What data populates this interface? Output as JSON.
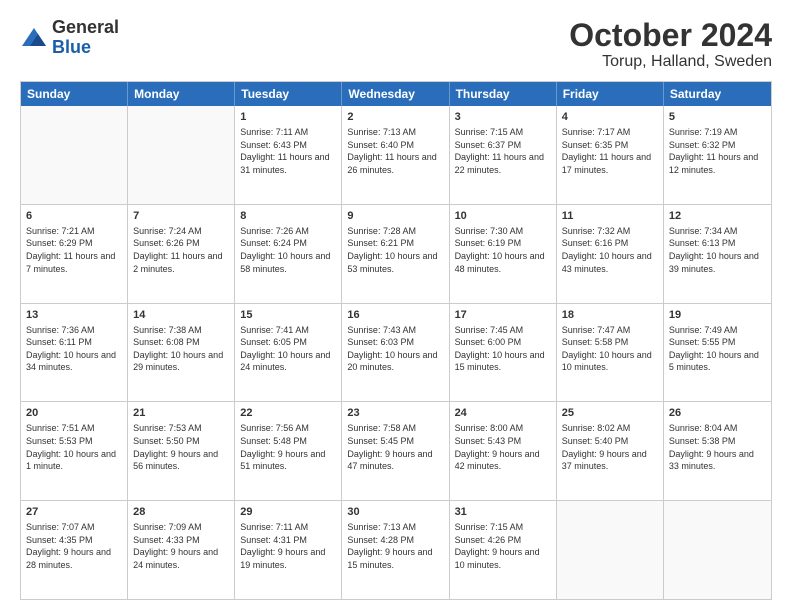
{
  "header": {
    "logo_general": "General",
    "logo_blue": "Blue",
    "title": "October 2024",
    "subtitle": "Torup, Halland, Sweden"
  },
  "days_of_week": [
    "Sunday",
    "Monday",
    "Tuesday",
    "Wednesday",
    "Thursday",
    "Friday",
    "Saturday"
  ],
  "weeks": [
    [
      {
        "day": "",
        "info": ""
      },
      {
        "day": "",
        "info": ""
      },
      {
        "day": "1",
        "info": "Sunrise: 7:11 AM\nSunset: 6:43 PM\nDaylight: 11 hours and 31 minutes."
      },
      {
        "day": "2",
        "info": "Sunrise: 7:13 AM\nSunset: 6:40 PM\nDaylight: 11 hours and 26 minutes."
      },
      {
        "day": "3",
        "info": "Sunrise: 7:15 AM\nSunset: 6:37 PM\nDaylight: 11 hours and 22 minutes."
      },
      {
        "day": "4",
        "info": "Sunrise: 7:17 AM\nSunset: 6:35 PM\nDaylight: 11 hours and 17 minutes."
      },
      {
        "day": "5",
        "info": "Sunrise: 7:19 AM\nSunset: 6:32 PM\nDaylight: 11 hours and 12 minutes."
      }
    ],
    [
      {
        "day": "6",
        "info": "Sunrise: 7:21 AM\nSunset: 6:29 PM\nDaylight: 11 hours and 7 minutes."
      },
      {
        "day": "7",
        "info": "Sunrise: 7:24 AM\nSunset: 6:26 PM\nDaylight: 11 hours and 2 minutes."
      },
      {
        "day": "8",
        "info": "Sunrise: 7:26 AM\nSunset: 6:24 PM\nDaylight: 10 hours and 58 minutes."
      },
      {
        "day": "9",
        "info": "Sunrise: 7:28 AM\nSunset: 6:21 PM\nDaylight: 10 hours and 53 minutes."
      },
      {
        "day": "10",
        "info": "Sunrise: 7:30 AM\nSunset: 6:19 PM\nDaylight: 10 hours and 48 minutes."
      },
      {
        "day": "11",
        "info": "Sunrise: 7:32 AM\nSunset: 6:16 PM\nDaylight: 10 hours and 43 minutes."
      },
      {
        "day": "12",
        "info": "Sunrise: 7:34 AM\nSunset: 6:13 PM\nDaylight: 10 hours and 39 minutes."
      }
    ],
    [
      {
        "day": "13",
        "info": "Sunrise: 7:36 AM\nSunset: 6:11 PM\nDaylight: 10 hours and 34 minutes."
      },
      {
        "day": "14",
        "info": "Sunrise: 7:38 AM\nSunset: 6:08 PM\nDaylight: 10 hours and 29 minutes."
      },
      {
        "day": "15",
        "info": "Sunrise: 7:41 AM\nSunset: 6:05 PM\nDaylight: 10 hours and 24 minutes."
      },
      {
        "day": "16",
        "info": "Sunrise: 7:43 AM\nSunset: 6:03 PM\nDaylight: 10 hours and 20 minutes."
      },
      {
        "day": "17",
        "info": "Sunrise: 7:45 AM\nSunset: 6:00 PM\nDaylight: 10 hours and 15 minutes."
      },
      {
        "day": "18",
        "info": "Sunrise: 7:47 AM\nSunset: 5:58 PM\nDaylight: 10 hours and 10 minutes."
      },
      {
        "day": "19",
        "info": "Sunrise: 7:49 AM\nSunset: 5:55 PM\nDaylight: 10 hours and 5 minutes."
      }
    ],
    [
      {
        "day": "20",
        "info": "Sunrise: 7:51 AM\nSunset: 5:53 PM\nDaylight: 10 hours and 1 minute."
      },
      {
        "day": "21",
        "info": "Sunrise: 7:53 AM\nSunset: 5:50 PM\nDaylight: 9 hours and 56 minutes."
      },
      {
        "day": "22",
        "info": "Sunrise: 7:56 AM\nSunset: 5:48 PM\nDaylight: 9 hours and 51 minutes."
      },
      {
        "day": "23",
        "info": "Sunrise: 7:58 AM\nSunset: 5:45 PM\nDaylight: 9 hours and 47 minutes."
      },
      {
        "day": "24",
        "info": "Sunrise: 8:00 AM\nSunset: 5:43 PM\nDaylight: 9 hours and 42 minutes."
      },
      {
        "day": "25",
        "info": "Sunrise: 8:02 AM\nSunset: 5:40 PM\nDaylight: 9 hours and 37 minutes."
      },
      {
        "day": "26",
        "info": "Sunrise: 8:04 AM\nSunset: 5:38 PM\nDaylight: 9 hours and 33 minutes."
      }
    ],
    [
      {
        "day": "27",
        "info": "Sunrise: 7:07 AM\nSunset: 4:35 PM\nDaylight: 9 hours and 28 minutes."
      },
      {
        "day": "28",
        "info": "Sunrise: 7:09 AM\nSunset: 4:33 PM\nDaylight: 9 hours and 24 minutes."
      },
      {
        "day": "29",
        "info": "Sunrise: 7:11 AM\nSunset: 4:31 PM\nDaylight: 9 hours and 19 minutes."
      },
      {
        "day": "30",
        "info": "Sunrise: 7:13 AM\nSunset: 4:28 PM\nDaylight: 9 hours and 15 minutes."
      },
      {
        "day": "31",
        "info": "Sunrise: 7:15 AM\nSunset: 4:26 PM\nDaylight: 9 hours and 10 minutes."
      },
      {
        "day": "",
        "info": ""
      },
      {
        "day": "",
        "info": ""
      }
    ]
  ]
}
